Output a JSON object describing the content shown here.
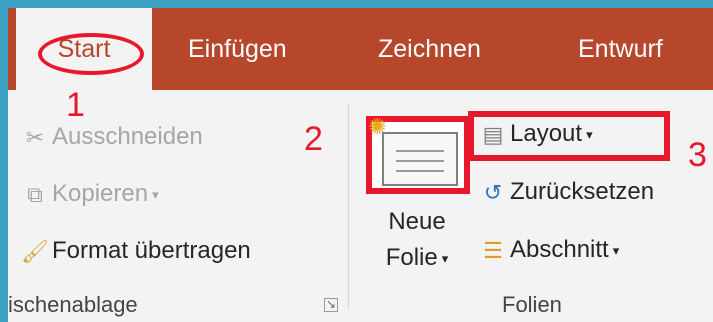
{
  "tabs": {
    "start": "Start",
    "einfuegen": "Einfügen",
    "zeichnen": "Zeichnen",
    "entwurf": "Entwurf"
  },
  "annotations": {
    "n1": "1",
    "n2": "2",
    "n3": "3"
  },
  "clipboard": {
    "cut": "Ausschneiden",
    "copy": "Kopieren",
    "paint": "Format übertragen",
    "group_label": "ischenablage"
  },
  "slides": {
    "new_line1": "Neue",
    "new_line2": "Folie",
    "layout": "Layout",
    "reset": "Zurücksetzen",
    "section": "Abschnitt",
    "group_label": "Folien"
  },
  "colors": {
    "tabbar": "#b7472a",
    "ribbon": "#f3f3f3",
    "annotation": "#e8182c",
    "background": "#3aa0c4"
  },
  "icons": [
    "scissors-icon",
    "copy-icon",
    "format-painter-icon",
    "new-slide-icon",
    "layout-icon",
    "reset-icon",
    "section-icon",
    "dialog-launcher-icon"
  ]
}
